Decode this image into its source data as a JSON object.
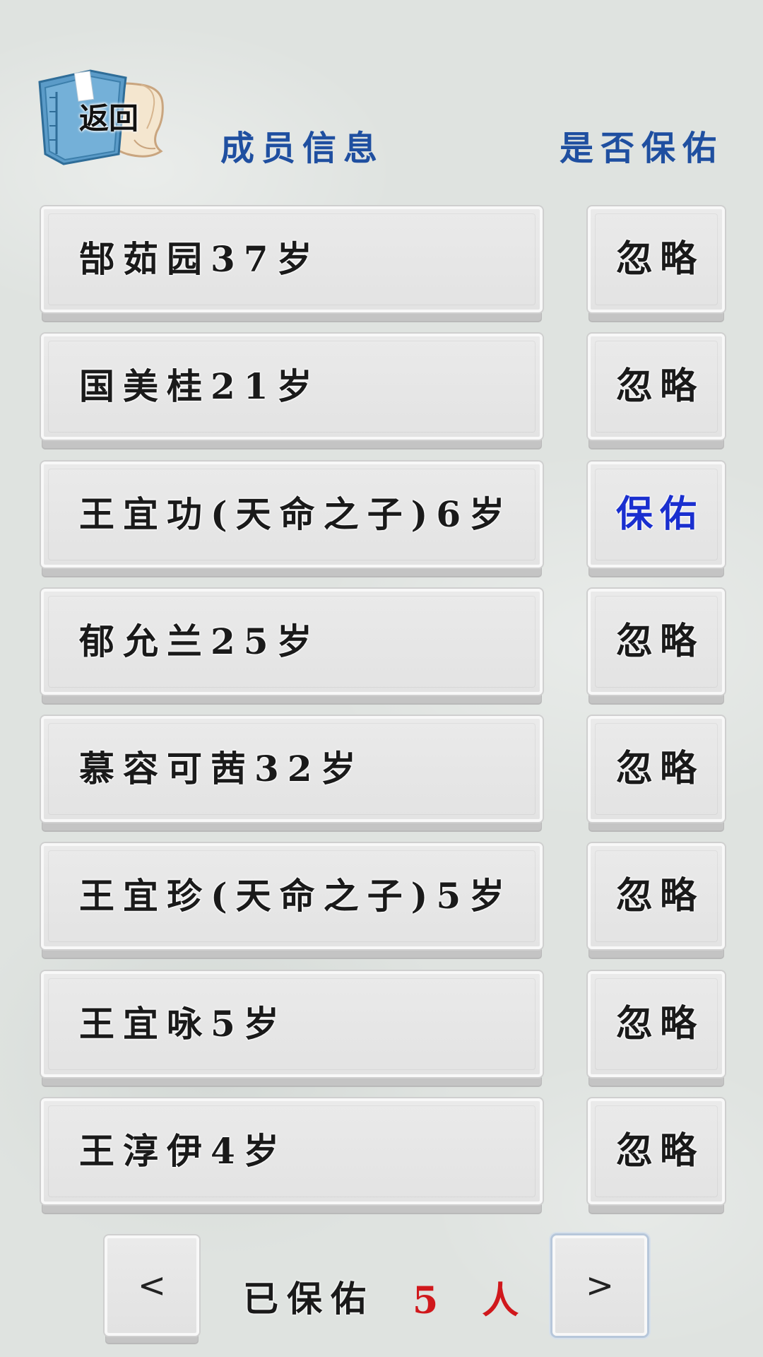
{
  "header": {
    "back_label": "返回",
    "member_info_title": "成员信息",
    "bless_title": "是否保佑"
  },
  "members": [
    {
      "info": "郜茹园37岁",
      "action": "忽略"
    },
    {
      "info": "国美桂21岁",
      "action": "忽略"
    },
    {
      "info": "王宜功(天命之子)6岁",
      "action": "保佑"
    },
    {
      "info": "郁允兰25岁",
      "action": "忽略"
    },
    {
      "info": "慕容可茜32岁",
      "action": "忽略"
    },
    {
      "info": "王宜珍(天命之子)5岁",
      "action": "忽略"
    },
    {
      "info": "王宜咏5岁",
      "action": "忽略"
    },
    {
      "info": "王淳伊4岁",
      "action": "忽略"
    }
  ],
  "footer": {
    "prev_label": "<",
    "next_label": ">",
    "protected_label": "已保佑",
    "protected_count": "5 人"
  },
  "colors": {
    "header_text": "#1f4fa0",
    "blessed_action": "#1a2fcf",
    "count_text": "#d0181c"
  },
  "icons": {
    "back": "book-scroll-icon"
  }
}
